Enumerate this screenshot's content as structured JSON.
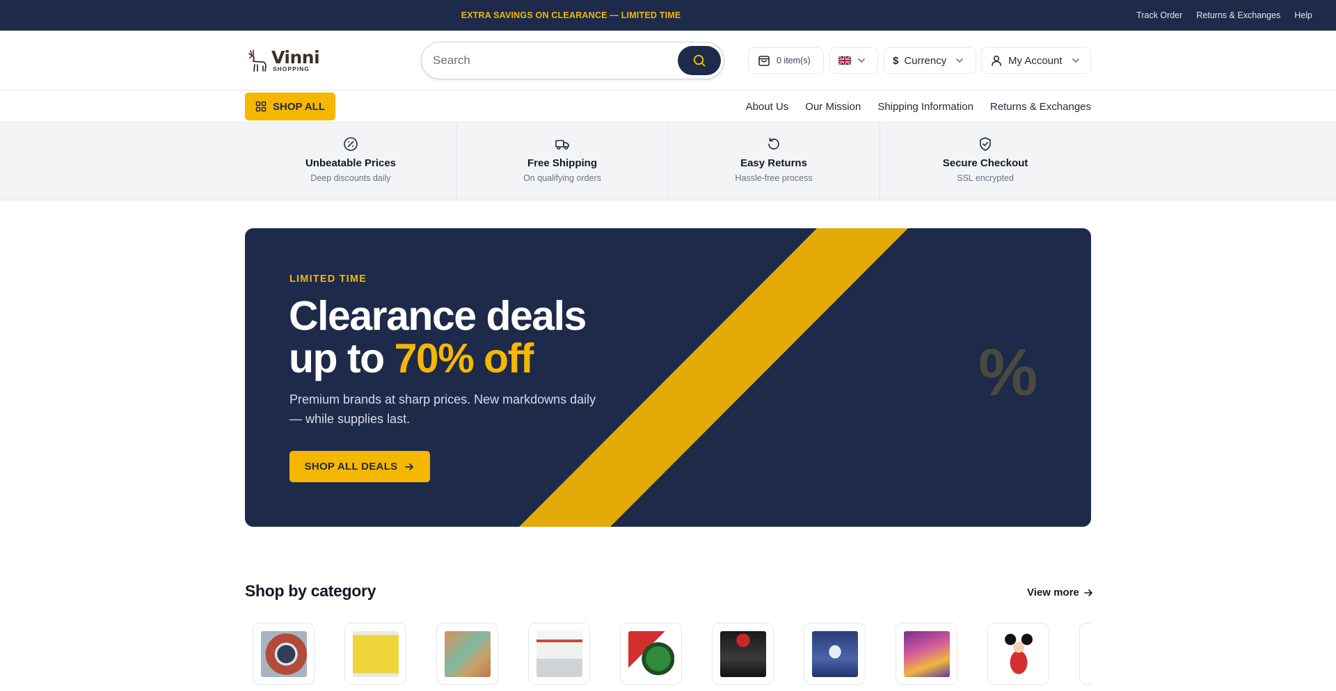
{
  "announcement": {
    "promo": "EXTRA SAVINGS ON CLEARANCE — LIMITED TIME",
    "links": [
      "Track Order",
      "Returns & Exchanges",
      "Help"
    ]
  },
  "header": {
    "logo": {
      "brand": "Vinni",
      "sub": "SHOPPING"
    },
    "search": {
      "placeholder": "Search",
      "value": ""
    },
    "cart_label": "0 item(s)",
    "language_flag": "uk-flag-icon",
    "currency_symbol": "$",
    "currency_label": "Currency",
    "account_label": "My Account"
  },
  "nav": {
    "shop_all_label": "SHOP ALL",
    "links": [
      "About Us",
      "Our Mission",
      "Shipping Information",
      "Returns & Exchanges"
    ]
  },
  "features": [
    {
      "icon": "discount-badge-icon",
      "title": "Unbeatable Prices",
      "desc": "Deep discounts daily"
    },
    {
      "icon": "truck-icon",
      "title": "Free Shipping",
      "desc": "On qualifying orders"
    },
    {
      "icon": "rotate-ccw-icon",
      "title": "Easy Returns",
      "desc": "Hassle-free process"
    },
    {
      "icon": "shield-check-icon",
      "title": "Secure Checkout",
      "desc": "SSL encrypted"
    }
  ],
  "hero": {
    "eyebrow": "LIMITED TIME",
    "headline_line1": "Clearance deals",
    "headline_line2_prefix": "up to ",
    "headline_highlight": "70% off",
    "subtext": "Premium brands at sharp prices. New markdowns daily — while supplies last.",
    "cta_label": "SHOP ALL DEALS",
    "decor_symbol": "%"
  },
  "categories": {
    "title": "Shop by category",
    "view_more_label": "View more",
    "items": [
      {
        "name": "category-anime-pin"
      },
      {
        "name": "category-yellow-jersey"
      },
      {
        "name": "category-art-print"
      },
      {
        "name": "category-baseball-card"
      },
      {
        "name": "category-mask-figure"
      },
      {
        "name": "category-electronics"
      },
      {
        "name": "category-anime-figure"
      },
      {
        "name": "category-trading-card"
      },
      {
        "name": "category-plush-toy"
      },
      {
        "name": "category-more"
      }
    ]
  },
  "colors": {
    "navy": "#1e2a4a",
    "accent": "#f5b700",
    "feature_bg": "#f3f4f6"
  }
}
